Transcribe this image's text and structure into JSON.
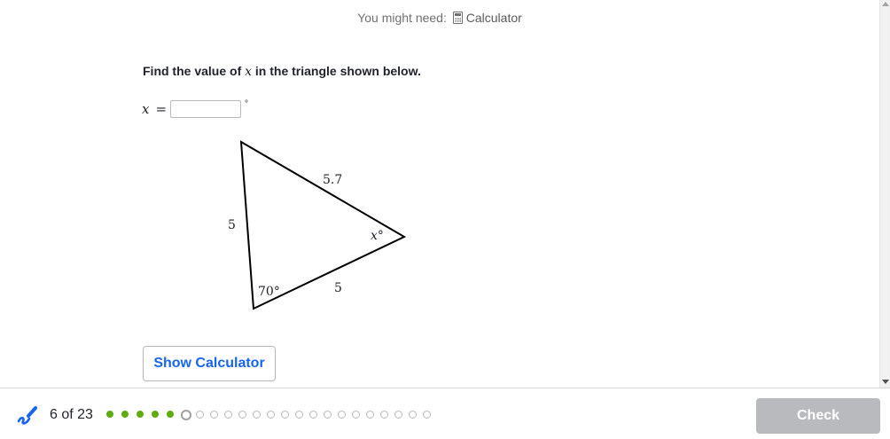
{
  "tools": {
    "prefix": "You might need:",
    "calculator_label": "Calculator"
  },
  "question": {
    "before": "Find the value of",
    "variable": "x",
    "after": "in the triangle shown below."
  },
  "answer": {
    "variable": "x",
    "equals": "=",
    "value": "",
    "unit": "°"
  },
  "figure": {
    "side_left": "5",
    "side_top_right": "5.7",
    "side_bottom": "5",
    "angle_bottom_left": "70°",
    "angle_right": "x°"
  },
  "buttons": {
    "show_calculator": "Show Calculator",
    "check": "Check"
  },
  "progress": {
    "label": "6 of 23",
    "completed": 5,
    "current": 6,
    "total": 23,
    "completed_color": "#5fac11"
  },
  "colors": {
    "link_blue": "#1865f2",
    "disabled_button": "#b8babe"
  }
}
